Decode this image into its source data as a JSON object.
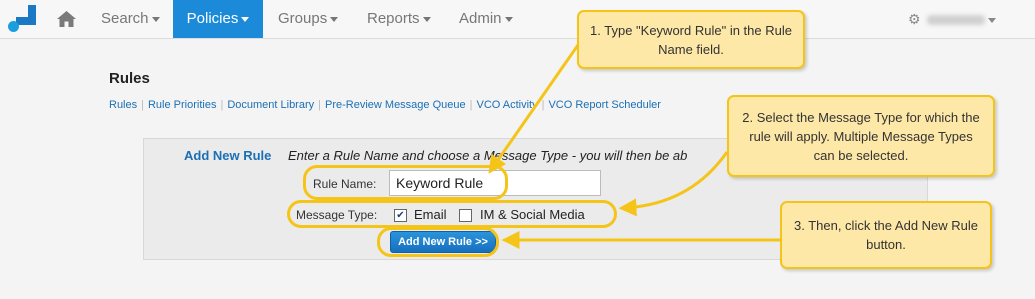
{
  "nav": {
    "items": [
      {
        "label": "Search",
        "active": false
      },
      {
        "label": "Policies",
        "active": true
      },
      {
        "label": "Groups",
        "active": false
      },
      {
        "label": "Reports",
        "active": false
      },
      {
        "label": "Admin",
        "active": false
      }
    ],
    "accent_color": "#1b8ad8"
  },
  "page": {
    "title": "Rules",
    "links": [
      "Rules",
      "Rule Priorities",
      "Document Library",
      "Pre-Review Message Queue",
      "VCO Activity",
      "VCO Report Scheduler"
    ]
  },
  "form": {
    "heading": "Add New Rule",
    "instructions": "Enter a Rule Name and choose a Message Type - you will then be ab",
    "rule_name_label": "Rule Name:",
    "rule_name_value": "Keyword Rule",
    "message_type_label": "Message Type:",
    "email_label": "Email",
    "email_checked": true,
    "im_label": "IM & Social Media",
    "im_checked": false,
    "submit_label": "Add New Rule >>"
  },
  "callouts": {
    "step1": "1. Type \"Keyword Rule\" in the Rule Name field.",
    "step2": "2. Select the Message Type for which the rule will apply. Multiple Message Types can be selected.",
    "step3": "3. Then, click the Add New Rule button."
  },
  "annotation_color": "#f5c419",
  "icons": [
    "logo-icon",
    "home-icon",
    "gear-icon",
    "chevron-down-icon",
    "checkmark-icon"
  ]
}
